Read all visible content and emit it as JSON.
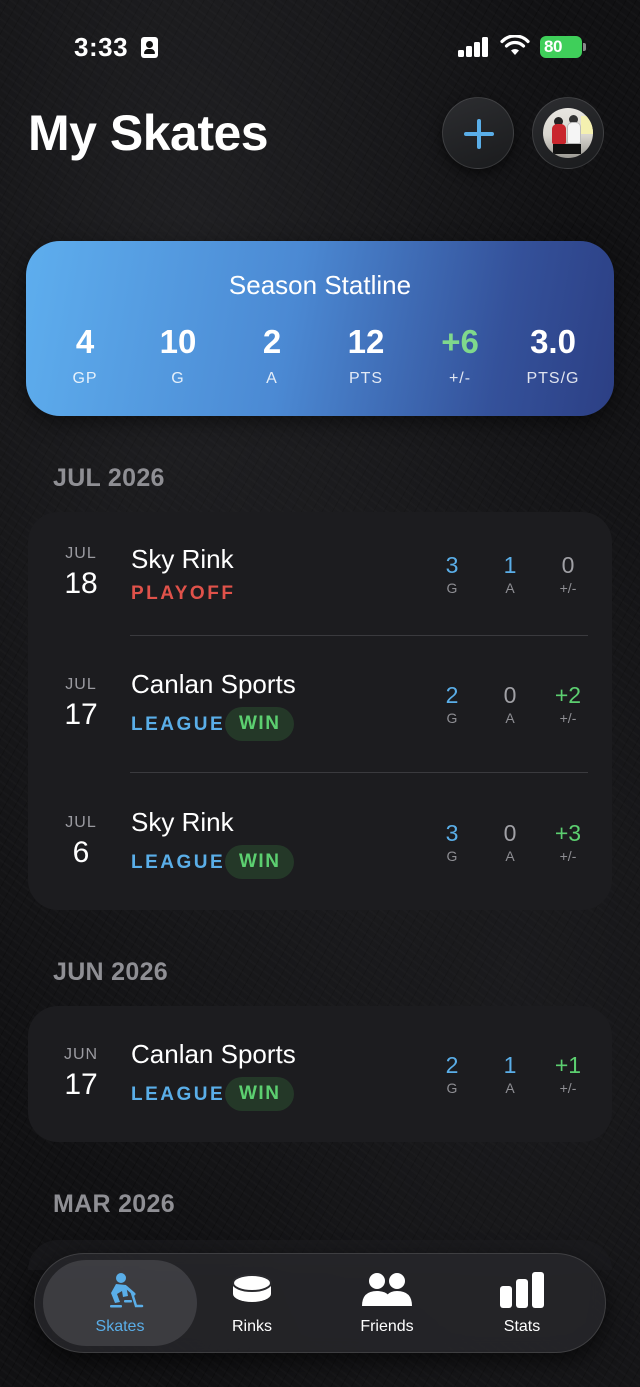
{
  "status_bar": {
    "time": "3:33",
    "battery": "80"
  },
  "header": {
    "title": "My Skates"
  },
  "season": {
    "title": "Season Statline",
    "stats": [
      {
        "value": "4",
        "label": "GP"
      },
      {
        "value": "10",
        "label": "G"
      },
      {
        "value": "2",
        "label": "A"
      },
      {
        "value": "12",
        "label": "PTS"
      },
      {
        "value": "+6",
        "label": "+/-"
      },
      {
        "value": "3.0",
        "label": "PTS/G"
      }
    ]
  },
  "sections": [
    {
      "header": "JUL 2026",
      "games": [
        {
          "month": "JUL",
          "day": "18",
          "rink": "Sky Rink",
          "type": "PLAYOFF",
          "result": "",
          "g": "3",
          "a": "1",
          "pm": "0"
        },
        {
          "month": "JUL",
          "day": "17",
          "rink": "Canlan Sports",
          "type": "LEAGUE",
          "result": "WIN",
          "g": "2",
          "a": "0",
          "pm": "+2"
        },
        {
          "month": "JUL",
          "day": "6",
          "rink": "Sky Rink",
          "type": "LEAGUE",
          "result": "WIN",
          "g": "3",
          "a": "0",
          "pm": "+3"
        }
      ]
    },
    {
      "header": "JUN 2026",
      "games": [
        {
          "month": "JUN",
          "day": "17",
          "rink": "Canlan Sports",
          "type": "LEAGUE",
          "result": "WIN",
          "g": "2",
          "a": "1",
          "pm": "+1"
        }
      ]
    },
    {
      "header": "MAR 2026",
      "games": []
    }
  ],
  "stat_labels": {
    "g": "G",
    "a": "A",
    "pm": "+/-"
  },
  "tabs": [
    {
      "label": "Skates",
      "icon": "hockey-player-icon",
      "active": true
    },
    {
      "label": "Rinks",
      "icon": "puck-icon",
      "active": false
    },
    {
      "label": "Friends",
      "icon": "friends-icon",
      "active": false
    },
    {
      "label": "Stats",
      "icon": "bar-chart-icon",
      "active": false
    }
  ],
  "colors": {
    "accent": "#5aaee8",
    "positive": "#5ccf70",
    "playoff": "#e0524a"
  }
}
